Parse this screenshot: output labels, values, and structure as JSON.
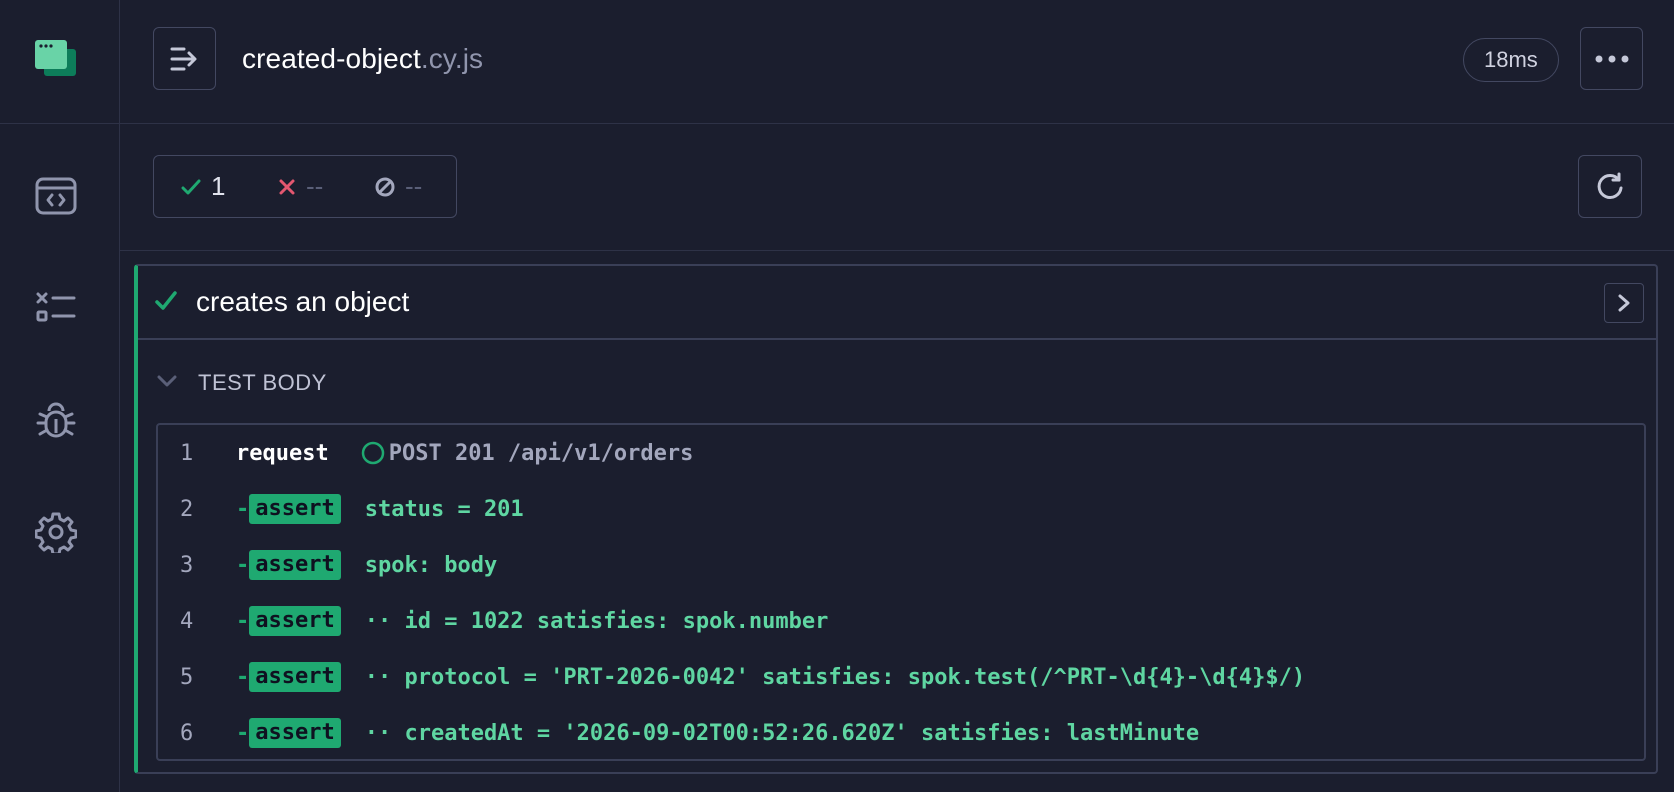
{
  "header": {
    "file_base": "created-object",
    "file_ext": ".cy.js",
    "duration": "18ms"
  },
  "stats": {
    "passed": "1",
    "failed": "--",
    "pending": "--"
  },
  "test": {
    "title": "creates an object",
    "section_title": "TEST BODY",
    "commands": [
      {
        "num": "1",
        "type": "request",
        "name": "request",
        "message": "POST 201 /api/v1/orders"
      },
      {
        "num": "2",
        "type": "assert",
        "name": "assert",
        "message": "status = 201"
      },
      {
        "num": "3",
        "type": "assert",
        "name": "assert",
        "message": "spok: body"
      },
      {
        "num": "4",
        "type": "assert",
        "name": "assert",
        "message": "·· id = 1022 satisfies: spok.number"
      },
      {
        "num": "5",
        "type": "assert",
        "name": "assert",
        "message": "·· protocol = 'PRT-2026-0042' satisfies: spok.test(/^PRT-\\d{4}-\\d{4}$/)"
      },
      {
        "num": "6",
        "type": "assert",
        "name": "assert",
        "message": "·· createdAt = '2026-09-02T00:52:26.620Z' satisfies: lastMinute"
      }
    ]
  },
  "icons": {
    "logo": "cypress-logo-icon",
    "specs": "code-window-icon",
    "runs": "test-list-icon",
    "debug": "bug-icon",
    "settings": "gear-icon",
    "toggle": "sidebar-toggle-icon",
    "more": "more-dots-icon",
    "rerun": "refresh-icon",
    "expand": "chevron-right-icon",
    "collapse": "chevron-down-icon"
  },
  "colors": {
    "background": "#1b1e2e",
    "passed": "#1fa971",
    "failed": "#e45770",
    "border": "#434861"
  }
}
